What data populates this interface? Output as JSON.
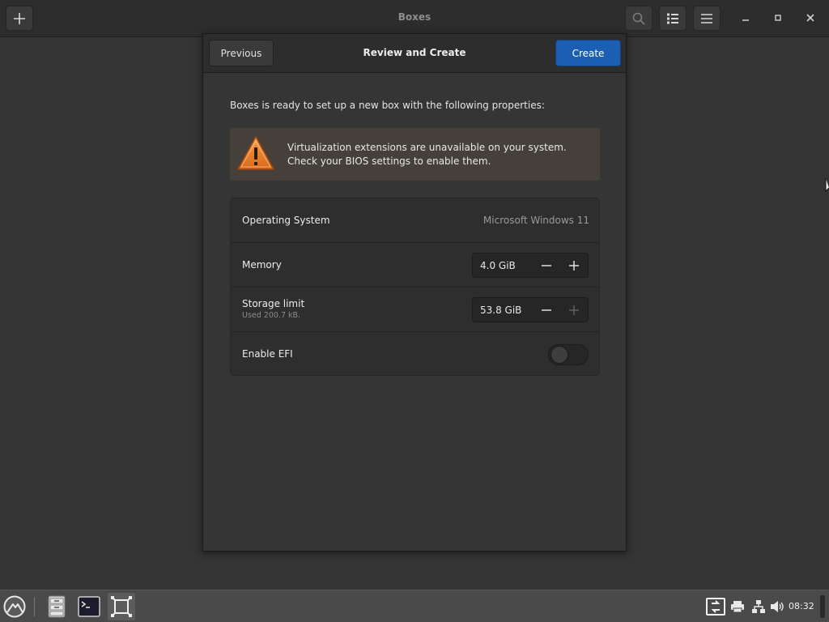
{
  "window": {
    "title": "Boxes",
    "controls": [
      "minimize-icon",
      "maximize-icon",
      "close-icon"
    ],
    "header_buttons": [
      "add-icon",
      "search-icon",
      "list-view-icon",
      "menu-icon"
    ]
  },
  "dialog": {
    "title": "Review and Create",
    "previous_label": "Previous",
    "create_label": "Create",
    "accent_color": "#1a5fb4",
    "intro": "Boxes is ready to set up a new box with the following properties:",
    "warning": {
      "icon": "warning-icon",
      "line1": "Virtualization extensions are unavailable on your system.",
      "line2": "Check your BIOS settings to enable them."
    },
    "properties": {
      "os": {
        "label": "Operating System",
        "value": "Microsoft Windows 11"
      },
      "memory": {
        "label": "Memory",
        "value": "4.0 GiB"
      },
      "storage": {
        "label": "Storage limit",
        "sub": "Used 200.7 kB.",
        "value": "53.8 GiB"
      },
      "efi": {
        "label": "Enable EFI",
        "enabled": false
      }
    }
  },
  "taskbar": {
    "apps": [
      "app-menu-icon",
      "file-manager-icon",
      "terminal-icon",
      "boxes-icon"
    ],
    "tray": [
      "display-switch-icon",
      "printer-icon",
      "network-icon",
      "volume-icon"
    ],
    "clock": "08:32"
  }
}
